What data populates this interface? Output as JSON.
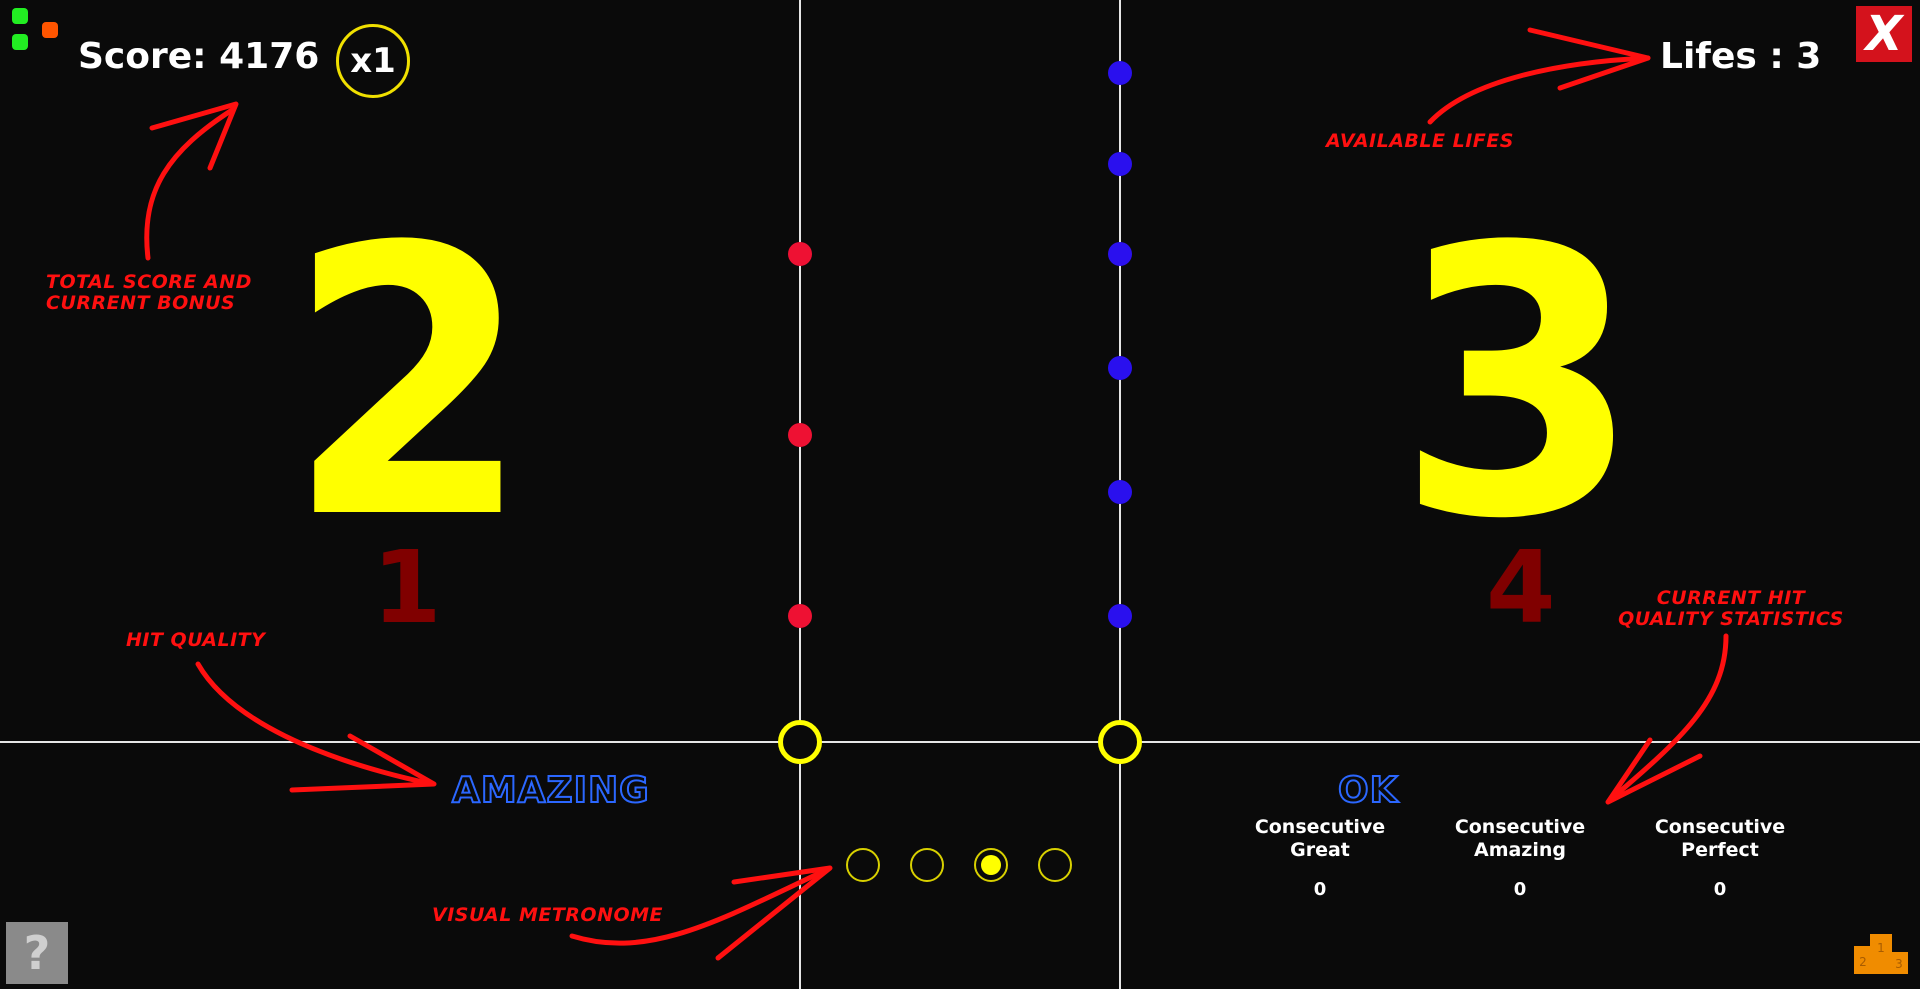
{
  "hud": {
    "score_label": "Score: 4176",
    "bonus_label": "x1",
    "lifes_label": "Lifes : 3"
  },
  "game": {
    "left_current": "2",
    "left_next": "1",
    "right_current": "3",
    "right_next": "4",
    "left_quality": "AMAZING",
    "right_quality": "OK",
    "metronome_active_index": 3,
    "metronome_total": 4
  },
  "stats": [
    {
      "label": "Consecutive Great",
      "value": "0"
    },
    {
      "label": "Consecutive Amazing",
      "value": "0"
    },
    {
      "label": "Consecutive Perfect",
      "value": "0"
    }
  ],
  "annotations": {
    "score": "TOTAL SCORE AND CURRENT  BONUS",
    "lifes": "AVAILABLE LIFES",
    "hit_quality": "HIT QUALITY",
    "stats": "CURRENT HIT QUALITY STATISTICS",
    "metronome": "VISUAL METRONOME"
  },
  "buttons": {
    "close_label": "X",
    "help_label": "?"
  },
  "colors": {
    "background": "#0a0a0a",
    "number_yellow": "#ffff00",
    "next_dark_red": "#800000",
    "left_notes": "#ee1133",
    "right_notes": "#2a10ee",
    "quality_blue": "#2b67ff",
    "annotation_red": "#ff1010"
  },
  "icons": {
    "menu": "menu-dots-icon",
    "close": "close-icon",
    "help": "help-icon",
    "leaderboard": "podium-icon"
  }
}
